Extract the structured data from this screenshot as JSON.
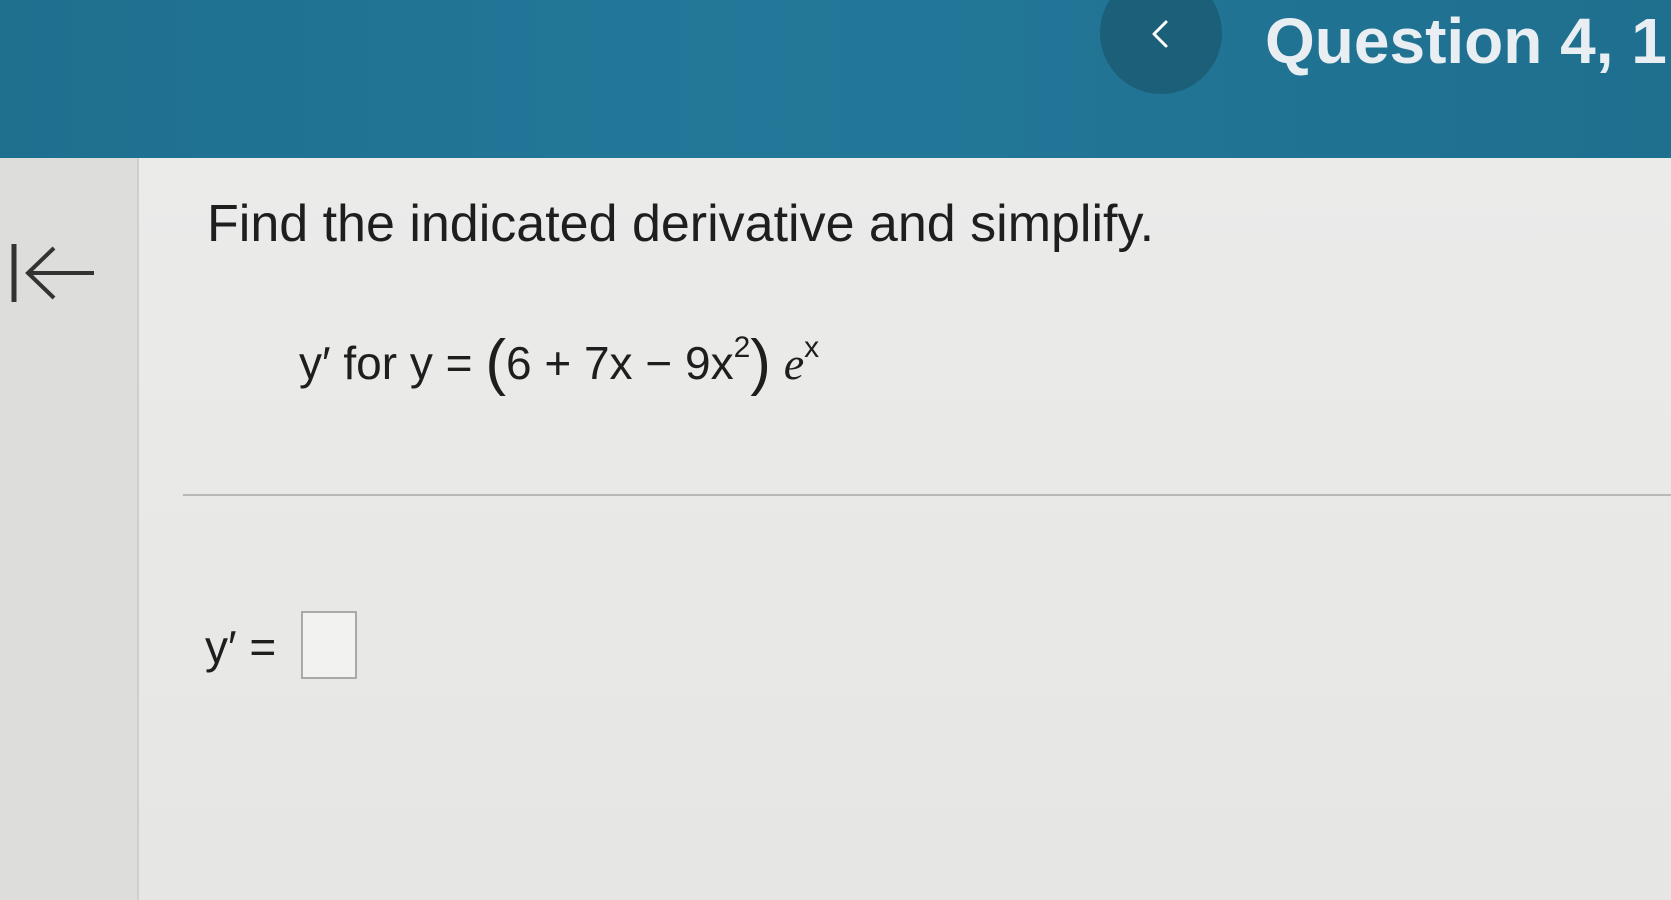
{
  "header": {
    "title": "Question 4, 1",
    "prev_icon": "chevron-left-icon",
    "color": "#237899"
  },
  "left_rail": {
    "back_icon": "arrow-left-to-bar-icon"
  },
  "problem": {
    "instruction": "Find the indicated derivative and simplify.",
    "y_prime_label": "y′",
    "for_word": "for",
    "y_var": "y",
    "equals": "=",
    "open_paren": "(",
    "expr_terms": "6 + 7x − 9x",
    "exponent": "2",
    "close_paren": ")",
    "e": "e",
    "e_exponent": "x"
  },
  "answer": {
    "label": "y′ =",
    "value": ""
  }
}
